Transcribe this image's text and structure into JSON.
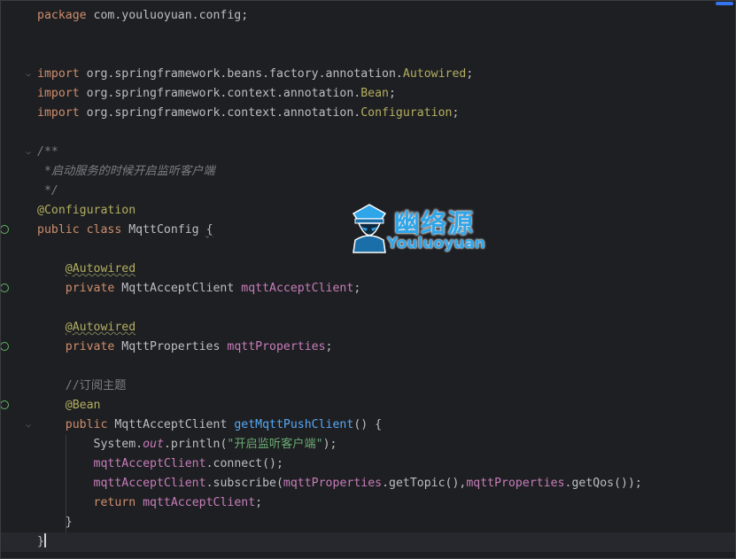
{
  "editor": {
    "lines": {
      "l1": {
        "kw": "package",
        "rest": " com.youluoyuan.config;"
      },
      "l4": {
        "kw": "import",
        "pkg": " org.springframework.beans.factory.annotation.",
        "cls": "Autowired",
        "end": ";"
      },
      "l5": {
        "kw": "import",
        "pkg": " org.springframework.context.annotation.",
        "cls": "Bean",
        "end": ";"
      },
      "l6": {
        "kw": "import",
        "pkg": " org.springframework.context.annotation.",
        "cls": "Configuration",
        "end": ";"
      },
      "l8": {
        "text": "/**"
      },
      "l9": {
        "text": " *启动服务的时候开启监听客户端"
      },
      "l10": {
        "text": " */"
      },
      "l11": {
        "ann": "@Configuration"
      },
      "l12": {
        "kw1": "public",
        "kw2": " class",
        "name": " MqttConfig ",
        "brace": "{"
      },
      "l14": {
        "ann": "@Autowired"
      },
      "l15": {
        "kw": "private",
        "type": " MqttAcceptClient ",
        "field": "mqttAcceptClient",
        "end": ";"
      },
      "l17": {
        "ann": "@Autowired"
      },
      "l18": {
        "kw": "private",
        "type": " MqttProperties ",
        "field": "mqttProperties",
        "end": ";"
      },
      "l20": {
        "comment": "//订阅主题"
      },
      "l21": {
        "ann": "@Bean"
      },
      "l22": {
        "kw": "public",
        "type": " MqttAcceptClient ",
        "method": "getMqttPushClient",
        "end": "() {"
      },
      "l23": {
        "a": "System.",
        "static": "out",
        "b": ".println(",
        "str": "\"开启监听客户端\"",
        "c": ");"
      },
      "l24": {
        "field": "mqttAcceptClient",
        "rest": ".connect();"
      },
      "l25": {
        "f1": "mqttAcceptClient",
        "a": ".subscribe(",
        "f2": "mqttProperties",
        "b": ".getTopic(),",
        "f3": "mqttProperties",
        "c": ".getQos());"
      },
      "l26": {
        "kw": "return",
        "field": " mqttAcceptClient",
        "end": ";"
      },
      "l27": {
        "text": "}"
      },
      "l28": {
        "text": "}"
      }
    }
  },
  "watermark": {
    "title_cn": "幽络源",
    "title_en": "Youluoyuan"
  },
  "colors": {
    "background": "#1e1f22",
    "keyword": "#cf8e6d",
    "annotation": "#b3ae60",
    "field": "#c77dbb",
    "method": "#56a8f5",
    "string": "#6aab73",
    "comment": "#7a7e85",
    "watermark": "#2fa5ea"
  },
  "icons": [
    "fold-arrow-icon",
    "bean-gutter-icon",
    "autowired-gutter-icon",
    "logo-icon"
  ]
}
